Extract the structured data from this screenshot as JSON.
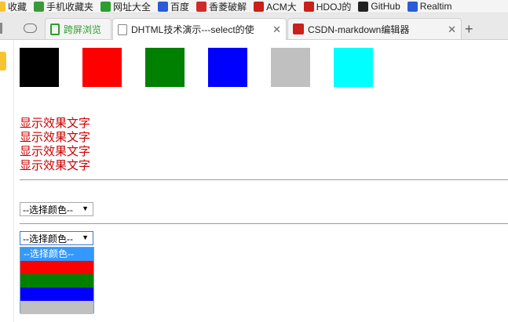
{
  "bookmarks": [
    {
      "label": "收藏",
      "icon": "star-icon",
      "color": "#f6c431"
    },
    {
      "label": "手机收藏夹",
      "icon": "phone-icon",
      "color": "#3a9a3a"
    },
    {
      "label": "网址大全",
      "icon": "green-cross-icon",
      "color": "#2c9f2c"
    },
    {
      "label": "百度",
      "icon": "baidu-paw-icon",
      "color": "#2b5bd6"
    },
    {
      "label": "香菱破解",
      "icon": "red-square-icon",
      "color": "#d12a2a"
    },
    {
      "label": "ACM大",
      "icon": "csdn-c-icon",
      "color": "#c9201b"
    },
    {
      "label": "HDOJ的",
      "icon": "csdn-c-icon",
      "color": "#c9201b"
    },
    {
      "label": "GitHub",
      "icon": "github-icon",
      "color": "#222222"
    },
    {
      "label": "Realtim",
      "icon": "globe-icon",
      "color": "#2b5bd6"
    }
  ],
  "tabs": [
    {
      "label": "跨屏浏览",
      "icon": "phone-icon",
      "color": "#2c9f2c",
      "active": false
    },
    {
      "label": "DHTML技术演示---select的使",
      "icon": "page-icon",
      "color": "#888888",
      "active": true
    },
    {
      "label": "CSDN-markdown编辑器",
      "icon": "csdn-c-icon",
      "color": "#c9201b",
      "active": false
    }
  ],
  "swatches": [
    "#000000",
    "#ff0000",
    "#008000",
    "#0000ff",
    "#c0c0c0",
    "#00ffff"
  ],
  "display_texts": [
    "显示效果文字",
    "显示效果文字",
    "显示效果文字",
    "显示效果文字"
  ],
  "display_color": "#cc0000",
  "select1": {
    "value": "--选择颜色--"
  },
  "select2": {
    "value": "--选择颜色--"
  },
  "dropdown_options": [
    {
      "label": "--选择颜色--",
      "color": "#3399ff"
    },
    {
      "label": "",
      "color": "#ff0000"
    },
    {
      "label": "",
      "color": "#008000"
    },
    {
      "label": "",
      "color": "#0000ff"
    },
    {
      "label": "",
      "color": "#c0c0c0"
    }
  ]
}
